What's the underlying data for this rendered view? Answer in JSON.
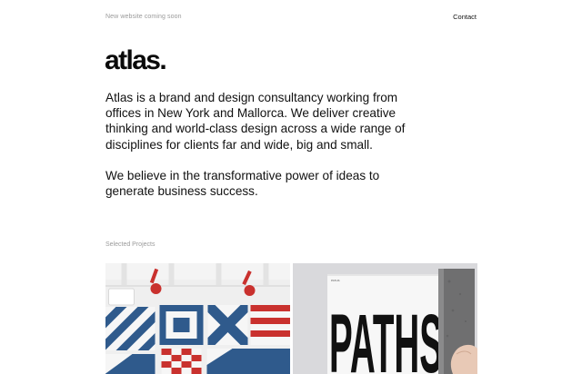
{
  "header": {
    "notice": "New website coming soon",
    "contact_label": "Contact"
  },
  "brand": {
    "logo_text": "atlas."
  },
  "intro": {
    "paragraphs": [
      "Atlas is a brand and design consultancy working from offices in New York and Mallorca. We deliver creative thinking and world-class design across a wide range of disciplines for clients far and wide, big and small.",
      "We believe in the transformative power of ideas to generate business success."
    ]
  },
  "projects": {
    "section_label": "Selected Projects",
    "items": [
      {
        "image": "nautical-flags-artwork"
      },
      {
        "image": "paths-magazine-spread",
        "cover_text": "PATHS"
      }
    ]
  },
  "colors": {
    "flag_blue": "#2f5a8c",
    "flag_red": "#c9312e",
    "muted_text": "#9a9a9a"
  }
}
